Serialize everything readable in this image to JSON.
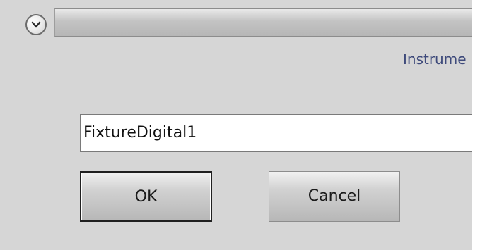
{
  "window": {
    "menu_icon": "chevron-down-icon"
  },
  "dialog": {
    "heading": "Instrume",
    "name_field_value": "FixtureDigital1",
    "buttons": {
      "ok_label": "OK",
      "cancel_label": "Cancel"
    }
  },
  "colors": {
    "dialog_background": "#d6d6d6",
    "heading_text": "#3e4a7b"
  }
}
